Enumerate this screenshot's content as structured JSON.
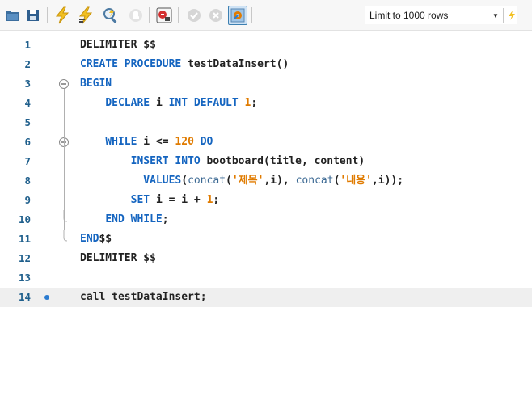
{
  "toolbar": {
    "buttons": [
      {
        "icon": "open-folder-icon"
      },
      {
        "icon": "save-icon"
      },
      {
        "icon": "execute-icon"
      },
      {
        "icon": "execute-current-icon"
      },
      {
        "icon": "explain-icon"
      },
      {
        "icon": "stop-icon"
      },
      {
        "icon": "toggle-error-icon"
      },
      {
        "icon": "commit-icon"
      },
      {
        "icon": "rollback-icon"
      },
      {
        "icon": "autocommit-icon"
      }
    ],
    "limit_select": {
      "value": "Limit to 1000 rows"
    },
    "colors": {
      "accent": "#3c7fb1",
      "execute": "#f2c021"
    }
  },
  "editor": {
    "current_line": 14,
    "colors": {
      "keyword": "#1565c0",
      "number": "#e07b00",
      "string": "#e07b00",
      "line_number": "#1f5f8c"
    },
    "lines": [
      {
        "num": "1",
        "tokens": [
          {
            "t": "id",
            "v": "DELIMITER $$"
          }
        ]
      },
      {
        "num": "2",
        "tokens": [
          {
            "t": "kw",
            "v": "CREATE PROCEDURE "
          },
          {
            "t": "id",
            "v": "testDataInsert()"
          }
        ]
      },
      {
        "num": "3",
        "tokens": [
          {
            "t": "kw",
            "v": "BEGIN"
          }
        ]
      },
      {
        "num": "4",
        "tokens": [
          {
            "t": "id",
            "v": "    "
          },
          {
            "t": "kw",
            "v": "DECLARE "
          },
          {
            "t": "id",
            "v": "i "
          },
          {
            "t": "kw",
            "v": "INT DEFAULT "
          },
          {
            "t": "num",
            "v": "1"
          },
          {
            "t": "id",
            "v": ";"
          }
        ]
      },
      {
        "num": "5",
        "tokens": []
      },
      {
        "num": "6",
        "tokens": [
          {
            "t": "id",
            "v": "    "
          },
          {
            "t": "kw",
            "v": "WHILE "
          },
          {
            "t": "id",
            "v": "i <= "
          },
          {
            "t": "num",
            "v": "120"
          },
          {
            "t": "kw",
            "v": " DO"
          }
        ]
      },
      {
        "num": "7",
        "tokens": [
          {
            "t": "id",
            "v": "        "
          },
          {
            "t": "kw",
            "v": "INSERT INTO "
          },
          {
            "t": "id",
            "v": "bootboard(title, content)"
          }
        ]
      },
      {
        "num": "8",
        "tokens": [
          {
            "t": "id",
            "v": "          "
          },
          {
            "t": "kw",
            "v": "VALUES"
          },
          {
            "t": "id",
            "v": "("
          },
          {
            "t": "fn",
            "v": "concat"
          },
          {
            "t": "id",
            "v": "("
          },
          {
            "t": "str",
            "v": "'제목'"
          },
          {
            "t": "id",
            "v": ",i), "
          },
          {
            "t": "fn",
            "v": "concat"
          },
          {
            "t": "id",
            "v": "("
          },
          {
            "t": "str",
            "v": "'내용'"
          },
          {
            "t": "id",
            "v": ",i));"
          }
        ]
      },
      {
        "num": "9",
        "tokens": [
          {
            "t": "id",
            "v": "        "
          },
          {
            "t": "kw",
            "v": "SET "
          },
          {
            "t": "id",
            "v": "i = i + "
          },
          {
            "t": "num",
            "v": "1"
          },
          {
            "t": "id",
            "v": ";"
          }
        ]
      },
      {
        "num": "10",
        "tokens": [
          {
            "t": "id",
            "v": "    "
          },
          {
            "t": "kw",
            "v": "END WHILE"
          },
          {
            "t": "id",
            "v": ";"
          }
        ]
      },
      {
        "num": "11",
        "tokens": [
          {
            "t": "kw",
            "v": "END"
          },
          {
            "t": "id",
            "v": "$$"
          }
        ]
      },
      {
        "num": "12",
        "tokens": [
          {
            "t": "id",
            "v": "DELIMITER $$"
          }
        ]
      },
      {
        "num": "13",
        "tokens": []
      },
      {
        "num": "14",
        "tokens": [
          {
            "t": "id",
            "v": "call testDataInsert;"
          }
        ]
      }
    ]
  }
}
